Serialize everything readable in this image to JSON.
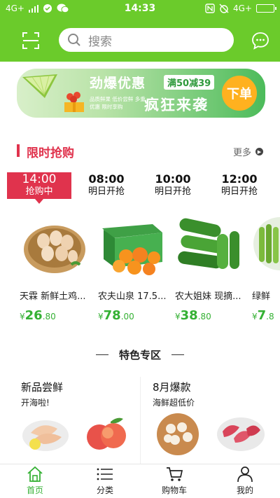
{
  "status_bar": {
    "network_left": "4G+",
    "time": "14:33",
    "network_right": "4G+"
  },
  "search": {
    "placeholder": "搜索"
  },
  "banner": {
    "title": "劲爆优惠",
    "tag": "满50减39",
    "small_text": "品质鲜果 低价尝鲜 多重优惠 限时享购",
    "subtitle": "疯狂来袭",
    "button": "下单"
  },
  "flash_sale": {
    "title": "限时抢购",
    "more": "更多",
    "time_slots": [
      {
        "time": "14:00",
        "status": "抢购中",
        "active": true
      },
      {
        "time": "08:00",
        "status": "明日开抢",
        "active": false
      },
      {
        "time": "10:00",
        "status": "明日开抢",
        "active": false
      },
      {
        "time": "12:00",
        "status": "明日开抢",
        "active": false
      }
    ],
    "products": [
      {
        "name": "天霖 新鲜土鸡...",
        "currency": "¥",
        "price_int": "26",
        "price_dec": ".80",
        "icon": "eggs-image"
      },
      {
        "name": "农夫山泉 17.5...",
        "currency": "¥",
        "price_int": "78",
        "price_dec": ".00",
        "icon": "orange-box-image"
      },
      {
        "name": "农大姐妹 现摘...",
        "currency": "¥",
        "price_int": "38",
        "price_dec": ".80",
        "icon": "cucumber-image"
      },
      {
        "name": "绿鲜",
        "currency": "¥",
        "price_int": "7",
        "price_dec": ".8",
        "icon": "beans-image"
      }
    ]
  },
  "special_zone": {
    "title": "特色专区",
    "cards": [
      {
        "title": "新品尝鲜",
        "subtitle": "开海啦!"
      },
      {
        "title": "8月爆款",
        "subtitle": "海鲜超低价"
      }
    ]
  },
  "tab_bar": [
    {
      "label": "首页",
      "icon": "home-icon",
      "active": true
    },
    {
      "label": "分类",
      "icon": "category-list-icon",
      "active": false
    },
    {
      "label": "购物车",
      "icon": "cart-icon",
      "active": false
    },
    {
      "label": "我的",
      "icon": "user-icon",
      "active": false
    }
  ],
  "colors": {
    "brand_green": "#6bcb2b",
    "flash_red": "#e0334d",
    "price_green": "#35b134"
  }
}
